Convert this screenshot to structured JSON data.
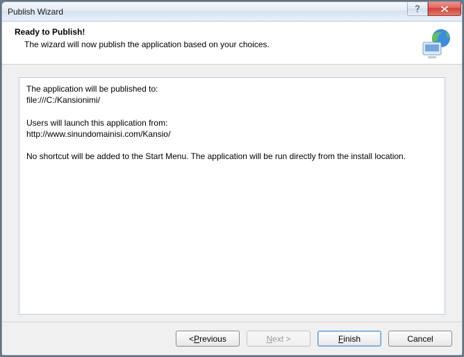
{
  "title": "Publish Wizard",
  "header": {
    "title": "Ready to Publish!",
    "subtitle": "The wizard will now publish the application based on your choices."
  },
  "summary": {
    "line1": "The application will be published to:",
    "publish_path": "file:///C:/Kansionimi/",
    "line2": "Users will launch this application from:",
    "launch_url": "http://www.sinundomainisi.com/Kansio/",
    "line3": "No shortcut will be added to the Start Menu. The application will be run directly from the install location."
  },
  "buttons": {
    "previous_prefix": "< ",
    "previous_u": "P",
    "previous_suffix": "revious",
    "next_u": "N",
    "next_suffix": "ext >",
    "finish_u": "F",
    "finish_suffix": "inish",
    "cancel": "Cancel"
  }
}
